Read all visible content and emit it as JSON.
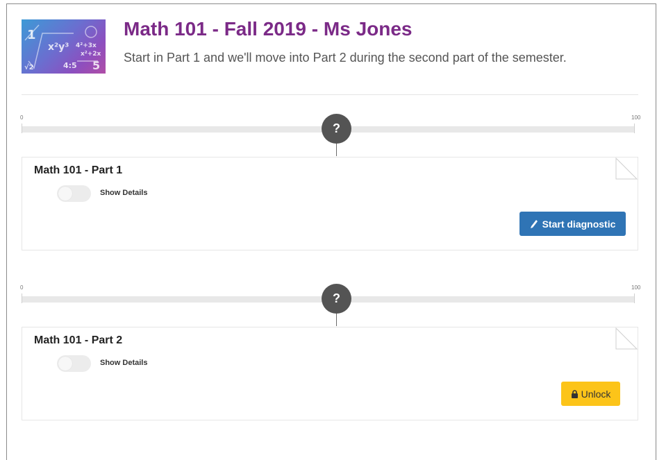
{
  "course": {
    "title": "Math 101 - Fall 2019 - Ms Jones",
    "description": "Start in Part 1 and we'll move into Part 2 during the second part of the semester.",
    "image_icon": "math-formulas-image"
  },
  "sections": [
    {
      "scale_min": "0",
      "scale_max": "100",
      "marker_label": "?",
      "title": "Math 101 - Part 1",
      "toggle_label": "Show Details",
      "toggle_on": false,
      "action_label": "Start diagnostic",
      "action_icon": "pencil-icon",
      "action_color": "#2f74b5"
    },
    {
      "scale_min": "0",
      "scale_max": "100",
      "marker_label": "?",
      "title": "Math 101 - Part 2",
      "toggle_label": "Show Details",
      "toggle_on": false,
      "action_label": "Unlock",
      "action_icon": "lock-icon",
      "action_color": "#fcc419"
    }
  ],
  "colors": {
    "title": "#7b2a87",
    "marker": "#545454"
  }
}
